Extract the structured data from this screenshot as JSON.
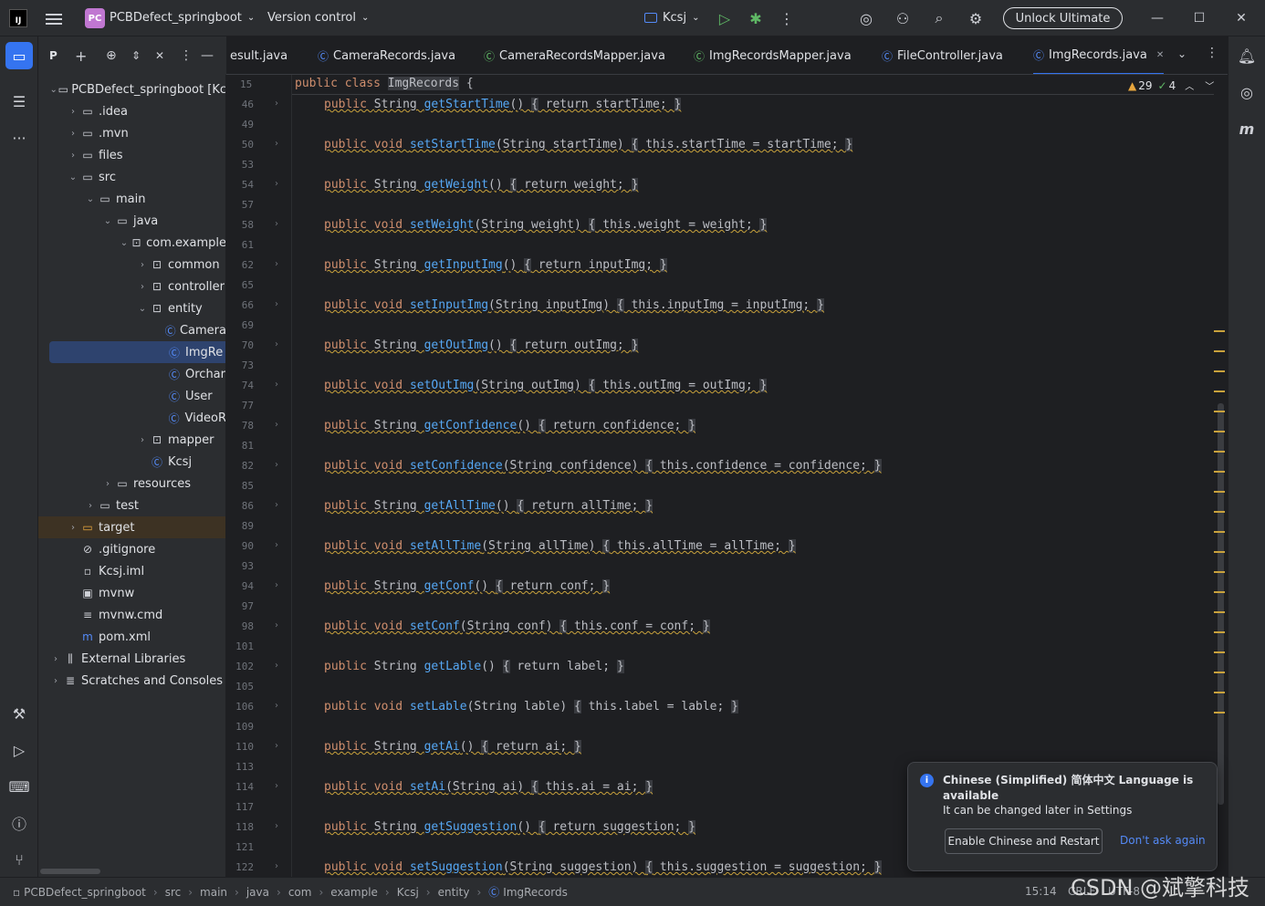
{
  "titlebar": {
    "project_badge": "PC",
    "project_name": "PCBDefect_springboot",
    "vcs": "Version control",
    "run_config": "Kcsj",
    "unlock": "Unlock Ultimate"
  },
  "project_panel": {
    "header": "P",
    "items": [
      {
        "label": "PCBDefect_springboot [Kc",
        "indent": 0,
        "chev": "⌄",
        "icon": "folder"
      },
      {
        "label": ".idea",
        "indent": 1,
        "chev": "›",
        "icon": "folder"
      },
      {
        "label": ".mvn",
        "indent": 1,
        "chev": "›",
        "icon": "folder"
      },
      {
        "label": "files",
        "indent": 1,
        "chev": "›",
        "icon": "folder"
      },
      {
        "label": "src",
        "indent": 1,
        "chev": "⌄",
        "icon": "folder"
      },
      {
        "label": "main",
        "indent": 2,
        "chev": "⌄",
        "icon": "folder"
      },
      {
        "label": "java",
        "indent": 3,
        "chev": "⌄",
        "icon": "folder"
      },
      {
        "label": "com.example",
        "indent": 4,
        "chev": "⌄",
        "icon": "package"
      },
      {
        "label": "common",
        "indent": 5,
        "chev": "›",
        "icon": "package"
      },
      {
        "label": "controller",
        "indent": 5,
        "chev": "›",
        "icon": "package"
      },
      {
        "label": "entity",
        "indent": 5,
        "chev": "⌄",
        "icon": "package"
      },
      {
        "label": "Camera",
        "indent": 6,
        "chev": "",
        "icon": "class"
      },
      {
        "label": "ImgRe",
        "indent": 6,
        "chev": "",
        "icon": "class",
        "selected": true
      },
      {
        "label": "Orchar",
        "indent": 6,
        "chev": "",
        "icon": "class"
      },
      {
        "label": "User",
        "indent": 6,
        "chev": "",
        "icon": "class"
      },
      {
        "label": "VideoR",
        "indent": 6,
        "chev": "",
        "icon": "class"
      },
      {
        "label": "mapper",
        "indent": 5,
        "chev": "›",
        "icon": "package"
      },
      {
        "label": "Kcsj",
        "indent": 5,
        "chev": "",
        "icon": "app"
      },
      {
        "label": "resources",
        "indent": 3,
        "chev": "›",
        "icon": "folder"
      },
      {
        "label": "test",
        "indent": 2,
        "chev": "›",
        "icon": "folder"
      },
      {
        "label": "target",
        "indent": 1,
        "chev": "›",
        "icon": "target",
        "excluded": true
      },
      {
        "label": ".gitignore",
        "indent": 1,
        "chev": "",
        "icon": "ignore"
      },
      {
        "label": "Kcsj.iml",
        "indent": 1,
        "chev": "",
        "icon": "file"
      },
      {
        "label": "mvnw",
        "indent": 1,
        "chev": "",
        "icon": "terminal"
      },
      {
        "label": "mvnw.cmd",
        "indent": 1,
        "chev": "",
        "icon": "lines"
      },
      {
        "label": "pom.xml",
        "indent": 1,
        "chev": "",
        "icon": "maven"
      },
      {
        "label": "External Libraries",
        "indent": 0,
        "chev": "›",
        "icon": "library"
      },
      {
        "label": "Scratches and Consoles",
        "indent": 0,
        "chev": "›",
        "icon": "scratch"
      }
    ]
  },
  "tabs": [
    {
      "label": "esult.java",
      "icon": ""
    },
    {
      "label": "CameraRecords.java",
      "icon": "class"
    },
    {
      "label": "CameraRecordsMapper.java",
      "icon": "interface"
    },
    {
      "label": "ImgRecordsMapper.java",
      "icon": "interface"
    },
    {
      "label": "FileController.java",
      "icon": "class"
    },
    {
      "label": "ImgRecords.java",
      "icon": "class",
      "active": true
    }
  ],
  "editor": {
    "sticky_line": "15",
    "sticky_kw": "public class ",
    "sticky_class": "ImgRecords",
    "sticky_rest": " {",
    "warnings": "29",
    "ok_count": "4",
    "lines": [
      {
        "n": "46",
        "n2": "49",
        "ret": "String",
        "name": "getStartTime",
        "args": "",
        "body": "return startTime;",
        "fieldLink": true
      },
      {
        "n": "50",
        "n2": "53",
        "ret": "void",
        "name": "setStartTime",
        "args": "String startTime",
        "body": "this.startTime = startTime;",
        "fieldLink": true
      },
      {
        "n": "54",
        "n2": "57",
        "ret": "String",
        "name": "getWeight",
        "args": "",
        "body": "return weight;",
        "fieldLink": false
      },
      {
        "n": "58",
        "n2": "61",
        "ret": "void",
        "name": "setWeight",
        "args": "String weight",
        "body": "this.weight = weight;",
        "fieldLink": true
      },
      {
        "n": "62",
        "n2": "65",
        "ret": "String",
        "name": "getInputImg",
        "args": "",
        "body": "return inputImg;",
        "fieldLink": false
      },
      {
        "n": "66",
        "n2": "69",
        "ret": "void",
        "name": "setInputImg",
        "args": "String inputImg",
        "body": "this.inputImg = inputImg;",
        "fieldLink": true
      },
      {
        "n": "70",
        "n2": "73",
        "ret": "String",
        "name": "getOutImg",
        "args": "",
        "body": "return outImg;",
        "fieldLink": false
      },
      {
        "n": "74",
        "n2": "77",
        "ret": "void",
        "name": "setOutImg",
        "args": "String outImg",
        "body": "this.outImg = outImg;",
        "fieldLink": true
      },
      {
        "n": "78",
        "n2": "81",
        "ret": "String",
        "name": "getConfidence",
        "args": "",
        "body": "return confidence;",
        "fieldLink": false
      },
      {
        "n": "82",
        "n2": "85",
        "ret": "void",
        "name": "setConfidence",
        "args": "String confidence",
        "body": "this.confidence = confidence;",
        "fieldLink": true
      },
      {
        "n": "86",
        "n2": "89",
        "ret": "String",
        "name": "getAllTime",
        "args": "",
        "body": "return allTime;",
        "fieldLink": false
      },
      {
        "n": "90",
        "n2": "93",
        "ret": "void",
        "name": "setAllTime",
        "args": "String allTime",
        "body": "this.allTime = allTime;",
        "fieldLink": true
      },
      {
        "n": "94",
        "n2": "97",
        "ret": "String",
        "name": "getConf",
        "args": "",
        "body": "return conf;",
        "fieldLink": true
      },
      {
        "n": "98",
        "n2": "101",
        "ret": "void",
        "name": "setConf",
        "args": "String conf",
        "body": "this.conf = conf;",
        "fieldLink": true
      },
      {
        "n": "102",
        "n2": "105",
        "ret": "String",
        "name": "getLable",
        "args": "",
        "body": "return label;",
        "fieldLink": true
      },
      {
        "n": "106",
        "n2": "109",
        "ret": "void",
        "name": "setLable",
        "args": "String lable",
        "body": "this.label = lable;",
        "fieldLink": true
      },
      {
        "n": "110",
        "n2": "113",
        "ret": "String",
        "name": "getAi",
        "args": "",
        "body": "return ai;",
        "fieldLink": false
      },
      {
        "n": "114",
        "n2": "117",
        "ret": "void",
        "name": "setAi",
        "args": "String ai",
        "body": "this.ai = ai;",
        "fieldLink": true
      },
      {
        "n": "118",
        "n2": "121",
        "ret": "String",
        "name": "getSuggestion",
        "args": "",
        "body": "return suggestion;",
        "fieldLink": false
      },
      {
        "n": "122",
        "n2": "",
        "ret": "void",
        "name": "setSuggestion",
        "args": "String suggestion",
        "body": "this.suggestion = suggestion;",
        "fieldLink": true
      }
    ]
  },
  "statusbar": {
    "crumbs": [
      "PCBDefect_springboot",
      "src",
      "main",
      "java",
      "com",
      "example",
      "Kcsj",
      "entity",
      "ImgRecords"
    ],
    "position": "15:14",
    "line_sep": "CRLF",
    "encoding": "UTF-8"
  },
  "notification": {
    "title": "Chinese (Simplified) 简体中文 Language is available",
    "body": "It can be changed later in Settings",
    "button": "Enable Chinese and Restart",
    "link": "Don't ask again"
  },
  "watermark": "CSDN @斌擎科技"
}
